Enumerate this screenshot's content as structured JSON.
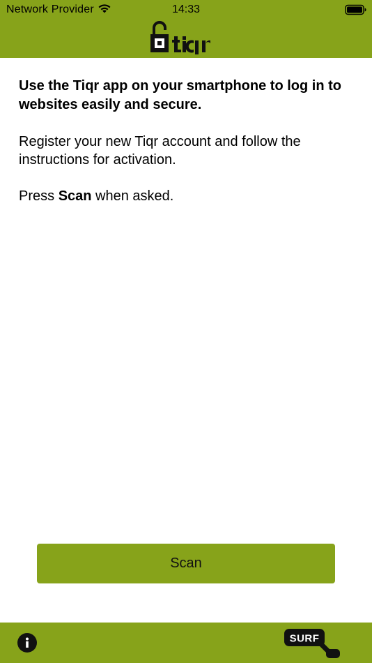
{
  "colors": {
    "brand_green": "#87A31A",
    "text": "#000000",
    "background": "#FFFFFF"
  },
  "status_bar": {
    "carrier": "Network Provider",
    "time": "14:33",
    "icons": [
      "wifi-icon",
      "battery-icon"
    ]
  },
  "header": {
    "logo": "tiqr",
    "logo_icon": "open-padlock-icon"
  },
  "main": {
    "intro": "Use the Tiqr app on your smartphone to log in to websites easily and secure.",
    "register_text": "Register your new Tiqr account and follow the instructions for activation.",
    "press_prefix": "Press ",
    "press_bold": "Scan",
    "press_suffix": " when asked."
  },
  "scan_button": {
    "label": "Scan"
  },
  "footer": {
    "info_icon": "info-icon",
    "surf_logo": "SURF"
  }
}
